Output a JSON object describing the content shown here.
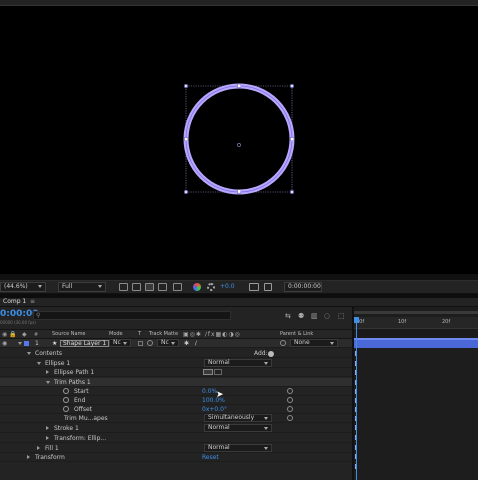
{
  "viewer": {
    "shape_stroke_color": "#b8a6ff",
    "bbox_color": "#9b9bd6"
  },
  "toolbar": {
    "zoom": "(44.6%)",
    "resolution": "Full",
    "exposure": "+0.0",
    "timecode": "0:00:00:00"
  },
  "timeline": {
    "tab": "Comp 1",
    "current_time": "0:00:00",
    "fps_info": "00000 (30.00 fps)",
    "search_placeholder": "",
    "ruler_ticks": [
      "00f",
      "10f",
      "20f"
    ],
    "columns": {
      "hash": "#",
      "source_name": "Source Name",
      "mode": "Mode",
      "t": "T",
      "track_matte": "Track Matte",
      "parent_link": "Parent & Link"
    },
    "layer": {
      "number": "1",
      "name": "Shape Layer 1",
      "mode": "Nc",
      "matte": "Nc",
      "parent": "None",
      "label_color": "#5577ee"
    },
    "rows": {
      "contents": "Contents",
      "add": "Add:",
      "ellipse": "Ellipse 1",
      "ellipse_mode": "Normal",
      "ellipse_path": "Ellipse Path 1",
      "trim_paths": "Trim Paths 1",
      "start": "Start",
      "start_val": "0.0%",
      "end": "End",
      "end_val": "100.0%",
      "offset": "Offset",
      "offset_val": "0x+0.0°",
      "trim_multiple": "Trim Mu...apes",
      "trim_multiple_val": "Simultaneously",
      "stroke": "Stroke 1",
      "stroke_mode": "Normal",
      "transform_ellipse": "Transform: Ellip...",
      "fill": "Fill 1",
      "fill_mode": "Normal",
      "transform": "Transform",
      "reset": "Reset"
    }
  }
}
